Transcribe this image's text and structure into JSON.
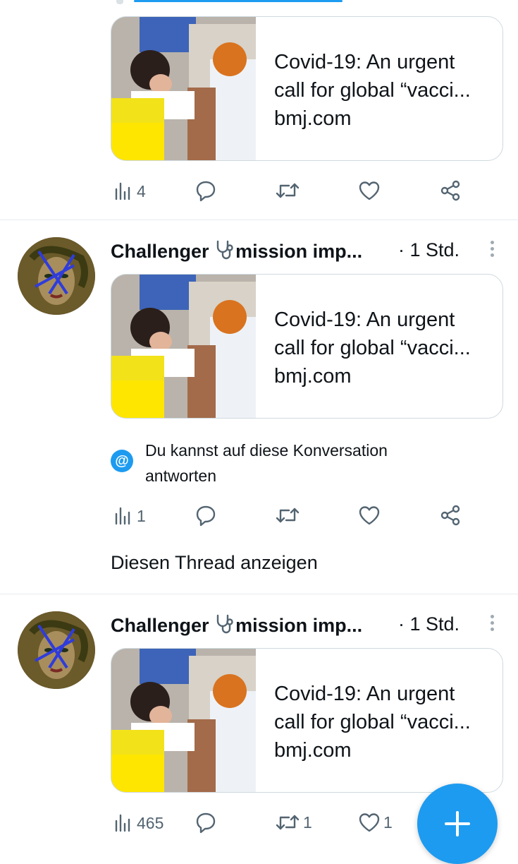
{
  "link_card": {
    "title_line1": "Covid-19: An urgent",
    "title_line2": "call for global “vacci...",
    "domain": "bmj.com"
  },
  "tweets": [
    {
      "views": "4",
      "retweets": "",
      "likes": ""
    },
    {
      "author": "Challenger",
      "author_emoji": "stethoscope-icon",
      "author_suffix": "mission imp...",
      "time": "· 1 Std.",
      "views": "1",
      "retweets": "",
      "likes": "",
      "notice": "Du kannst auf diese Konversation antworten",
      "thread_link": "Diesen Thread anzeigen"
    },
    {
      "author": "Challenger",
      "author_emoji": "stethoscope-icon",
      "author_suffix": "mission imp...",
      "time": "· 1 Std.",
      "views": "465",
      "retweets": "1",
      "likes": "1"
    }
  ],
  "fab": {
    "icon": "plus-icon",
    "color": "#1d9bf0"
  },
  "colors": {
    "accent": "#1d9bf0",
    "icon_gray": "#536471",
    "divider": "#e6ecf0"
  }
}
